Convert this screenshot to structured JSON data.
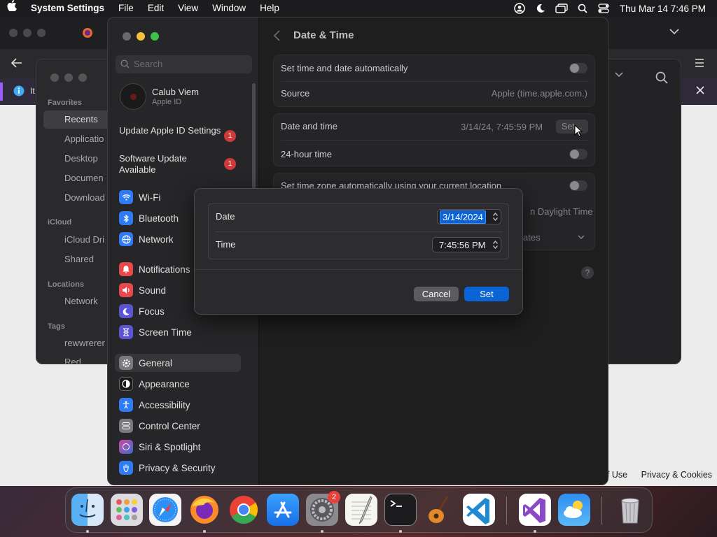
{
  "menubar": {
    "app_name": "System Settings",
    "menus": [
      "File",
      "Edit",
      "View",
      "Window",
      "Help"
    ],
    "clock": "Thu Mar 14  7:46 PM"
  },
  "browser": {
    "infobar_text": "It",
    "footer_terms": "of Use",
    "footer_privacy": "Privacy & Cookies"
  },
  "finder": {
    "favorites_header": "Favorites",
    "favorites": [
      "Recents",
      "Applicatio",
      "Desktop",
      "Documen",
      "Download"
    ],
    "icloud_header": "iCloud",
    "icloud": [
      "iCloud Dri",
      "Shared"
    ],
    "locations_header": "Locations",
    "locations": [
      "Network"
    ],
    "tags_header": "Tags",
    "tags": [
      "rewwrerer",
      "Red"
    ]
  },
  "settings": {
    "search_placeholder": "Search",
    "user_name": "Calub Viem",
    "user_sub": "Apple ID",
    "notices": [
      {
        "label": "Update Apple ID Settings",
        "badge": "1"
      },
      {
        "label": "Software Update Available",
        "badge": "1"
      }
    ],
    "group1": [
      "Wi-Fi",
      "Bluetooth",
      "Network"
    ],
    "group2": [
      "Notifications",
      "Sound",
      "Focus",
      "Screen Time"
    ],
    "group3": [
      "General",
      "Appearance",
      "Accessibility",
      "Control Center",
      "Siri & Spotlight",
      "Privacy & Security"
    ],
    "page_title": "Date & Time",
    "rows": {
      "auto_set": "Set time and date automatically",
      "source_label": "Source",
      "source_value": "Apple (time.apple.com.)",
      "datetime_label": "Date and time",
      "datetime_value": "3/14/24, 7:45:59 PM",
      "set_button": "Set...",
      "hour24": "24-hour time",
      "tz_auto": "Set time zone automatically using your current location",
      "dst_partial": "n Daylight Time",
      "region_partial": "ates"
    },
    "help": "?"
  },
  "dialog": {
    "date_label": "Date",
    "date_value": "3/14/2024",
    "time_label": "Time",
    "time_value": "7:45:56 PM",
    "cancel": "Cancel",
    "set": "Set"
  },
  "dock": {
    "apps": [
      "Finder",
      "Launchpad",
      "Safari",
      "Firefox",
      "Chrome",
      "App Store",
      "System Settings",
      "TextEdit",
      "Terminal",
      "GarageBand",
      "Visual Studio Code",
      "Visual Studio",
      "Weather",
      "Trash"
    ],
    "settings_badge": "2"
  },
  "colors": {
    "accent": "#0a64d6",
    "badge": "#d03a3a"
  }
}
